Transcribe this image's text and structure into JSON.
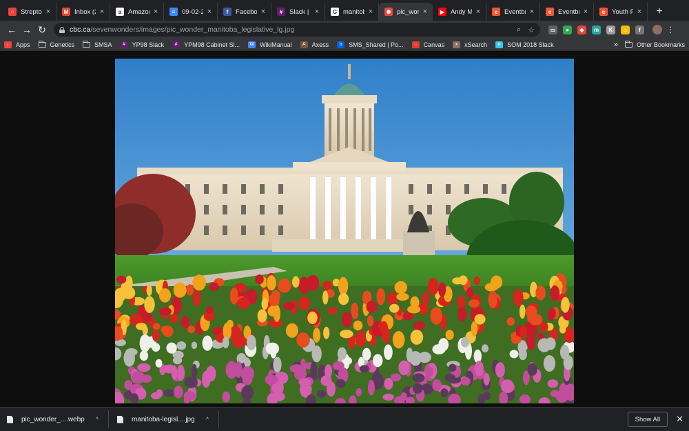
{
  "tabs": [
    {
      "title": "Streptoc",
      "icon": "streptoc-favicon",
      "color": "#e8453c",
      "glyph": "◌",
      "active": false
    },
    {
      "title": "Inbox (2",
      "icon": "gmail-favicon",
      "color": "#ea4335",
      "glyph": "M",
      "active": false
    },
    {
      "title": "Amazon",
      "icon": "amazon-favicon",
      "color": "#ffffff",
      "glyph": "a",
      "active": false
    },
    {
      "title": "09-02-2",
      "icon": "google-docs-favicon",
      "color": "#4285f4",
      "glyph": "≡",
      "active": false
    },
    {
      "title": "Faceboo",
      "icon": "facebook-favicon",
      "color": "#3b5998",
      "glyph": "f",
      "active": false
    },
    {
      "title": "Slack | ",
      "icon": "slack-favicon",
      "color": "#611f69",
      "glyph": "#",
      "active": false
    },
    {
      "title": "manitob",
      "icon": "google-favicon",
      "color": "#ffffff",
      "glyph": "G",
      "active": false
    },
    {
      "title": "pic_won",
      "icon": "cbc-favicon",
      "color": "#e8453c",
      "glyph": "✺",
      "active": true
    },
    {
      "title": "Andy Ma",
      "icon": "youtube-favicon",
      "color": "#ff0000",
      "glyph": "▶",
      "active": false
    },
    {
      "title": "Eventbri",
      "icon": "eventbrite-favicon",
      "color": "#f05537",
      "glyph": "e",
      "active": false
    },
    {
      "title": "Eventbri",
      "icon": "eventbrite-favicon",
      "color": "#f05537",
      "glyph": "e",
      "active": false
    },
    {
      "title": "Youth Pe",
      "icon": "eventbrite-favicon",
      "color": "#f05537",
      "glyph": "e",
      "active": false
    }
  ],
  "toolbar": {
    "url_host": "cbc.ca",
    "url_path": "/sevenwonders/images/pic_wonder_manitoba_legislative_lg.jpg"
  },
  "bookmarks": [
    {
      "label": "Apps",
      "icon": "apps-grid-icon",
      "color": "#e8453c",
      "glyph": "⋮"
    },
    {
      "label": "Genetics",
      "icon": "folder-icon",
      "folder": true
    },
    {
      "label": "SMSA",
      "icon": "folder-icon",
      "folder": true
    },
    {
      "label": "YP98 Slack",
      "icon": "slack-icon",
      "color": "#611f69",
      "glyph": "#"
    },
    {
      "label": "YPM98 Cabinet Sl...",
      "icon": "slack-icon",
      "color": "#611f69",
      "glyph": "#"
    },
    {
      "label": "WikiManual",
      "icon": "wiki-icon",
      "color": "#4285f4",
      "glyph": "W"
    },
    {
      "label": "Axess",
      "icon": "axess-icon",
      "color": "#795548",
      "glyph": "A"
    },
    {
      "label": "SMS_Shared | Po...",
      "icon": "box-icon",
      "color": "#0061d5",
      "glyph": "b"
    },
    {
      "label": "Canvas",
      "icon": "canvas-icon",
      "color": "#e03e2d",
      "glyph": "◌"
    },
    {
      "label": "xSearch",
      "icon": "xsearch-icon",
      "color": "#8d6e63",
      "glyph": "x"
    },
    {
      "label": "SOM 2018 Slack",
      "icon": "slack-icon",
      "color": "#36c5f0",
      "glyph": "#"
    }
  ],
  "bookmarks_other": "Other Bookmarks",
  "downloads": [
    {
      "name": "pic_wonder_....webp"
    },
    {
      "name": "manitoba-legisl....jpg"
    }
  ],
  "download_bar": {
    "show_all": "Show All"
  }
}
